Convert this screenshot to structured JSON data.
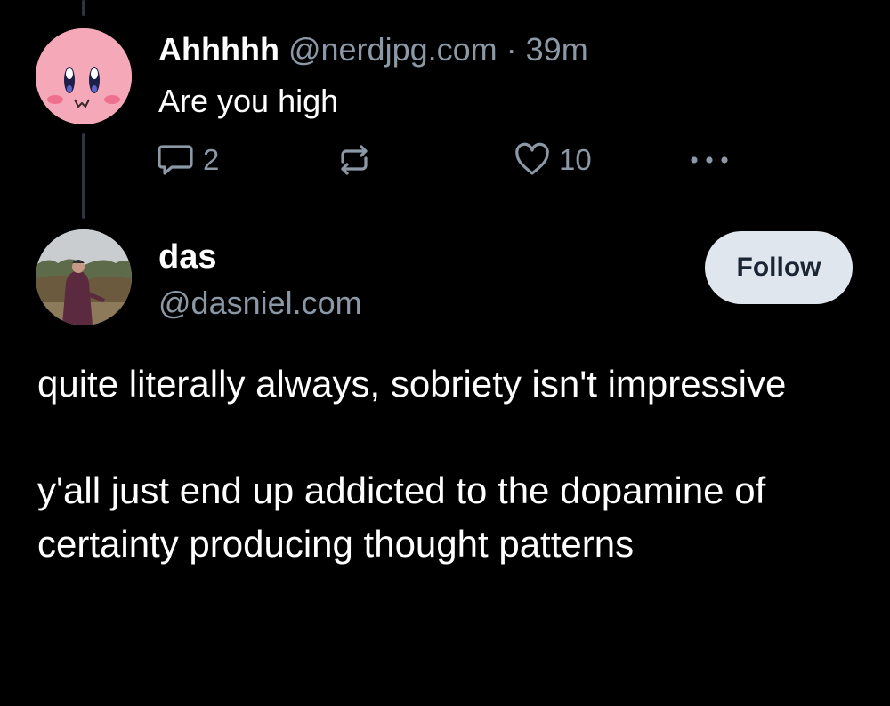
{
  "parent_post": {
    "display_name": "Ahhhhh",
    "handle": "@nerdjpg.com",
    "separator": "·",
    "timestamp": "39m",
    "text": "Are you high",
    "reply_count": "2",
    "like_count": "10",
    "avatar_icon": "kirby-avatar-icon"
  },
  "reply_post": {
    "display_name": "das",
    "handle": "@dasniel.com",
    "follow_label": "Follow",
    "avatar_icon": "profile-photo-avatar",
    "paragraphs": [
      "quite literally always, sobriety isn't impressive",
      "y'all just end up addicted to the dopamine of certainty producing thought patterns"
    ]
  },
  "colors": {
    "background": "#000000",
    "muted_text": "#8b98a5",
    "thread_line": "#2e3440",
    "follow_bg": "#dfe6ee",
    "follow_text": "#1b2634"
  }
}
